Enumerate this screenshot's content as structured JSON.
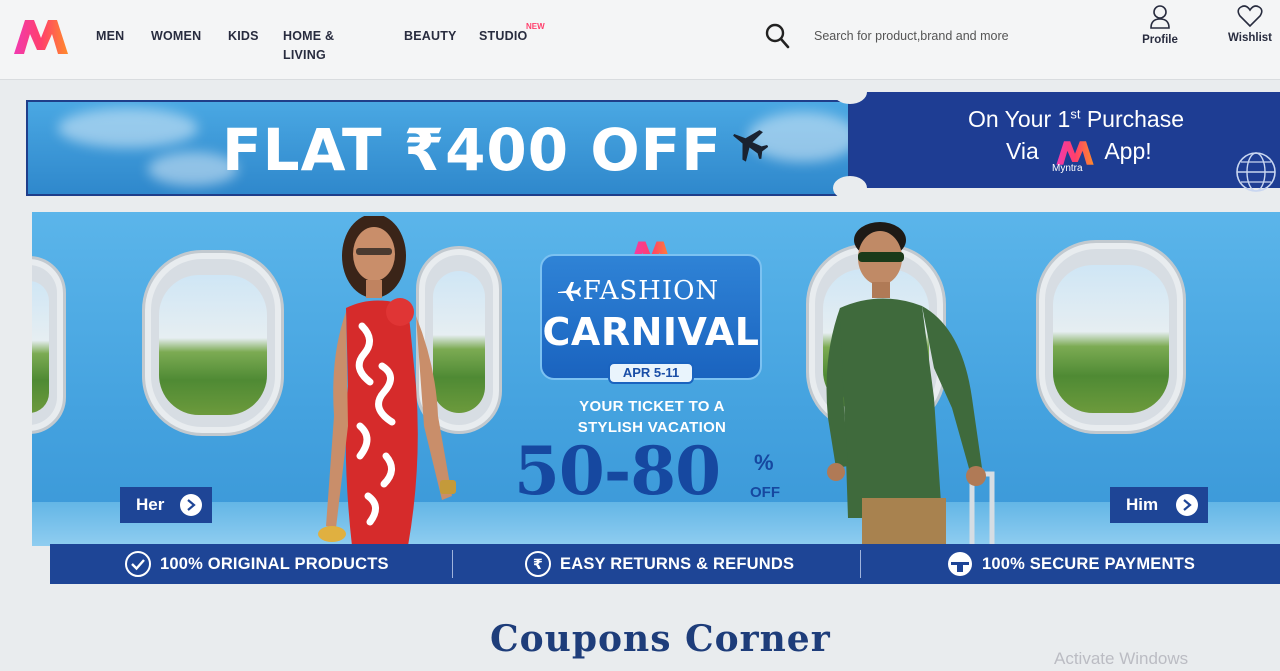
{
  "header": {
    "nav": [
      "MEN",
      "WOMEN",
      "KIDS",
      "HOME &",
      "LIVING",
      "BEAUTY",
      "STUDIO"
    ],
    "studio_badge": "NEW",
    "search_placeholder": "Search for product,brand and more",
    "profile_label": "Profile",
    "wishlist_label": "Wishlist",
    "brand_color": "#ff3f6c"
  },
  "offer": {
    "headline": "FLAT ₹400 OFF",
    "line1_prefix": "On Your 1",
    "line1_sup": "st",
    "line1_suffix": " Purchase",
    "line2_prefix": "Via",
    "line2_suffix": "App!",
    "brand_name": "Myntra"
  },
  "banner": {
    "fashion": "FASHION",
    "carnival": "CARNIVAL",
    "dates": "APR 5-11",
    "tagline_1": "YOUR TICKET TO A",
    "tagline_2": "STYLISH VACATION",
    "discount": "50-80",
    "discount_pct": "%",
    "discount_off": "OFF",
    "cta_her": "Her",
    "cta_him": "Him"
  },
  "trust": [
    {
      "icon": "check-circle-icon",
      "label": "100% ORIGINAL PRODUCTS"
    },
    {
      "icon": "rupee-circle-icon",
      "label": "EASY RETURNS & REFUNDS"
    },
    {
      "icon": "secure-payment-icon",
      "label": "100% SECURE PAYMENTS"
    }
  ],
  "section_title": "Coupons Corner",
  "watermark": "Activate Windows"
}
